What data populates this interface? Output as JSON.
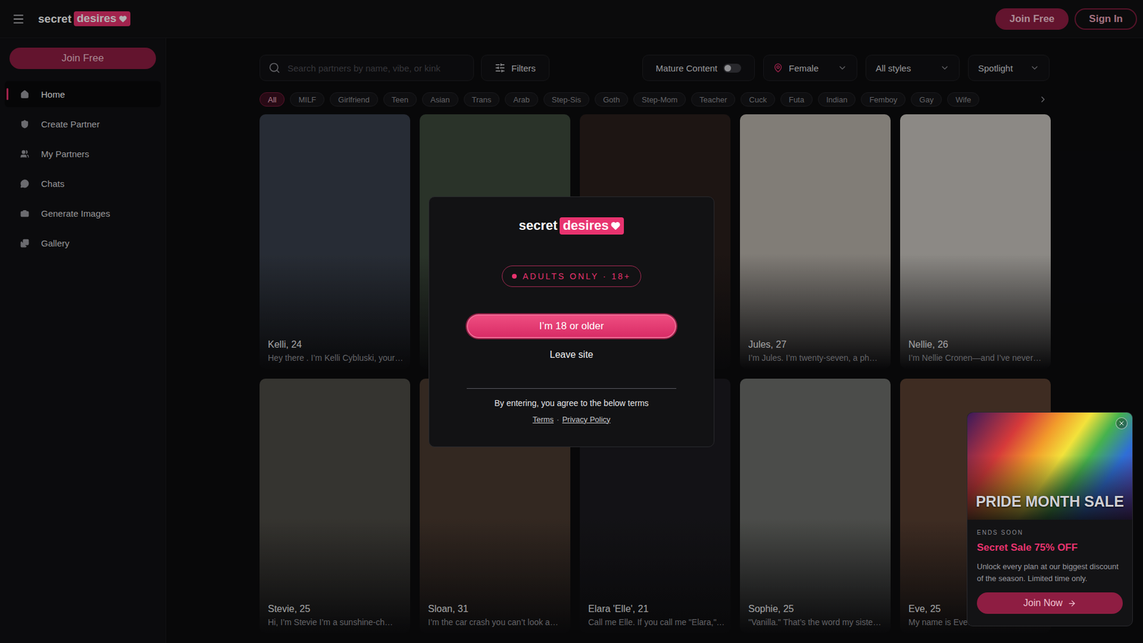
{
  "header": {
    "logo": {
      "word": "secret",
      "badge": "desires"
    },
    "join": "Join Free",
    "signin": "Sign In"
  },
  "sidebar": {
    "cta": "Join Free",
    "items": [
      {
        "label": "Home",
        "selected": true
      },
      {
        "label": "Create Partner",
        "selected": false
      },
      {
        "label": "My Partners",
        "selected": false
      },
      {
        "label": "Chats",
        "selected": false
      },
      {
        "label": "Generate Images",
        "selected": false
      },
      {
        "label": "Gallery",
        "selected": false
      }
    ]
  },
  "toolbar": {
    "search": {
      "placeholder": "Search partners by name, vibe, or kink"
    },
    "filters": "Filters",
    "mature": {
      "label": "Mature Content",
      "on": false
    },
    "selects": [
      "Female",
      "All styles",
      "Spotlight"
    ]
  },
  "tags": [
    {
      "label": "All",
      "selected": true
    },
    {
      "label": "MILF",
      "selected": false
    },
    {
      "label": "Girlfriend",
      "selected": false
    },
    {
      "label": "Teen",
      "selected": false
    },
    {
      "label": "Asian",
      "selected": false
    },
    {
      "label": "Trans",
      "selected": false
    },
    {
      "label": "Arab",
      "selected": false
    },
    {
      "label": "Step-Sis",
      "selected": false
    },
    {
      "label": "Goth",
      "selected": false
    },
    {
      "label": "Step-Mom",
      "selected": false
    },
    {
      "label": "Teacher",
      "selected": false
    },
    {
      "label": "Cuck",
      "selected": false
    },
    {
      "label": "Futa",
      "selected": false
    },
    {
      "label": "Indian",
      "selected": false
    },
    {
      "label": "Femboy",
      "selected": false
    },
    {
      "label": "Gay",
      "selected": false
    },
    {
      "label": "Wife",
      "selected": false
    }
  ],
  "cards": [
    {
      "name": "Kelli, 24",
      "bio": "Hey there . I’m Kelli Cybluski, your…"
    },
    {
      "name": "",
      "bio": ""
    },
    {
      "name": "",
      "bio": ""
    },
    {
      "name": "Jules, 27",
      "bio": "I’m Jules. I’m twenty-seven, a ph…"
    },
    {
      "name": "Nellie, 26",
      "bio": "I’m Nellie Cronen—and I’ve never…"
    },
    {
      "name": "Stevie, 25",
      "bio": "Hi, I’m Stevie  I’m a sunshine-ch…"
    },
    {
      "name": "Sloan, 31",
      "bio": "I’m the car crash you can’t look a…"
    },
    {
      "name": "Elara 'Elle', 21",
      "bio": "Call me Elle. If you call me \"Elara,\"…"
    },
    {
      "name": "Sophie, 25",
      "bio": "\"Vanilla.\" That’s the word my siste…"
    },
    {
      "name": "Eve, 25",
      "bio": "My name is Eve…"
    }
  ],
  "age_gate": {
    "logo": {
      "word": "secret",
      "badge": "desires"
    },
    "badge": "ADULTS ONLY · 18+",
    "confirm": "I’m 18 or older",
    "leave": "Leave site",
    "agree": "By entering, you agree to the below terms",
    "links": [
      "Terms",
      "Privacy Policy"
    ],
    "separator": "·"
  },
  "promo": {
    "banner": "PRIDE MONTH SALE",
    "eyebrow": "ENDS SOON",
    "title": "Secret Sale 75% OFF",
    "text": "Unlock every plan at our biggest discount of the season. Limited time only.",
    "button": "Join Now"
  }
}
